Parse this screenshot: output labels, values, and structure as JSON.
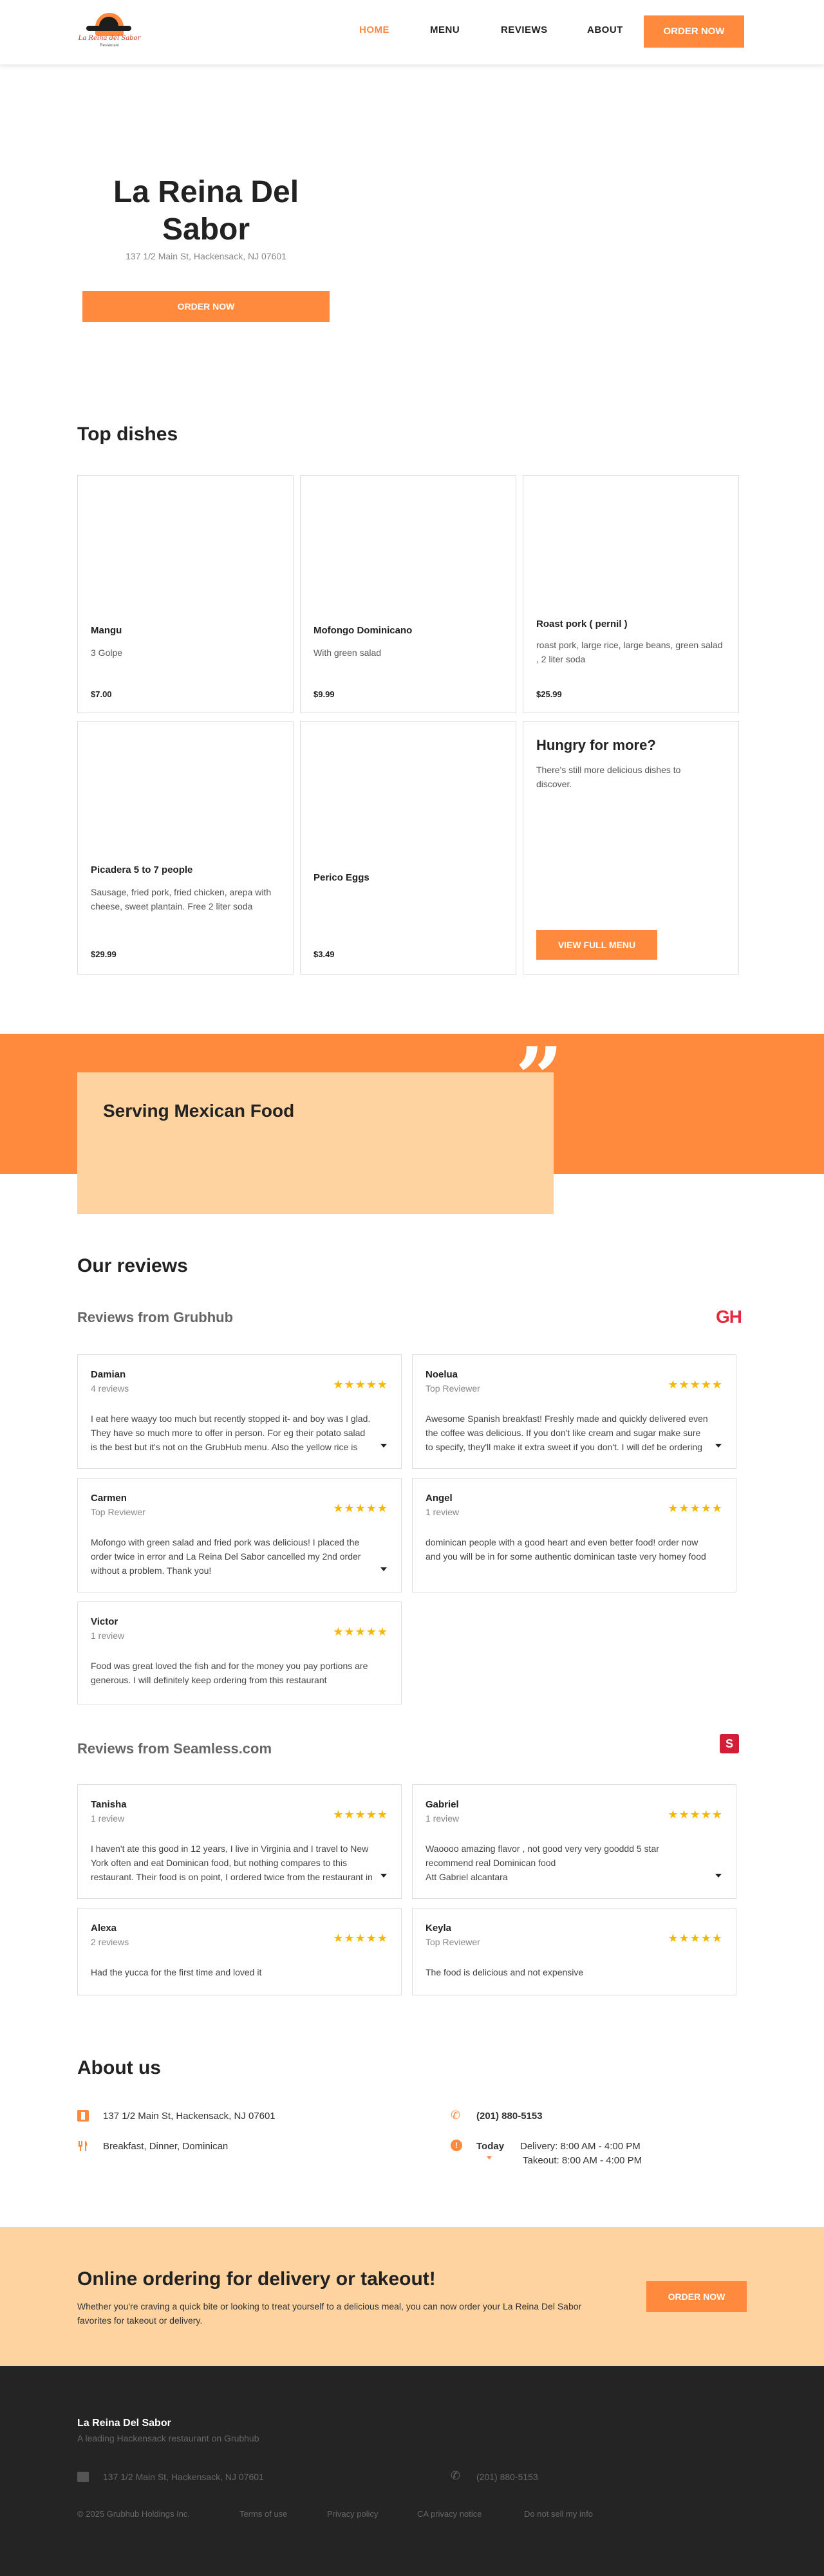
{
  "header": {
    "logo_text": "La Reina del Sabor",
    "logo_subtext": "Restaurant",
    "nav": [
      "HOME",
      "MENU",
      "REVIEWS",
      "ABOUT"
    ],
    "order_label": "ORDER NOW"
  },
  "hero": {
    "title": "La Reina Del Sabor",
    "address": "137 1/2 Main St, Hackensack, NJ 07601",
    "order_label": "ORDER NOW"
  },
  "top_dishes": {
    "heading": "Top dishes",
    "items": [
      {
        "name": "Mangu",
        "desc": "3 Golpe",
        "price": "$7.00"
      },
      {
        "name": "Mofongo Dominicano",
        "desc": "With green salad",
        "price": "$9.99"
      },
      {
        "name": "Roast pork ( pernil )",
        "desc": "roast pork, large rice, large beans, green salad , 2 liter soda",
        "price": "$25.99"
      },
      {
        "name": "Picadera 5 to 7 people",
        "desc": "Sausage, fried pork, fried chicken, arepa with cheese, sweet plantain. Free 2 liter soda",
        "price": "$29.99"
      },
      {
        "name": "Perico Eggs",
        "desc": "",
        "price": "$3.49"
      }
    ],
    "more": {
      "title": "Hungry for more?",
      "desc": "There's still more delicious dishes to discover.",
      "button": "VIEW FULL MENU"
    }
  },
  "band": {
    "title": "Serving Mexican Food"
  },
  "reviews": {
    "heading": "Our reviews",
    "grubhub": {
      "heading": "Reviews from Grubhub",
      "logo": "GH",
      "items": [
        {
          "name": "Damian",
          "sub": "4 reviews",
          "stars": "★★★★★",
          "text": "I eat here waayy too much but recently stopped it- and boy was I glad. They have so much more to offer in person. For eg their potato salad is the best but it's not on the GrubHub menu. Also the yellow rice is cooked differently and that's the best!"
        },
        {
          "name": "Noelua",
          "sub": "Top Reviewer",
          "stars": "★★★★★",
          "text": "Awesome Spanish breakfast! Freshly made and quickly delivered even the coffee was delicious. If you don't like cream and sugar make sure to specify, they'll make it extra sweet if you don't. I will def be ordering again!"
        },
        {
          "name": "Carmen",
          "sub": "Top Reviewer",
          "stars": "★★★★★",
          "text": "Mofongo with green salad and fried pork was delicious! I placed the order twice in error and La Reina Del Sabor cancelled my 2nd order without a problem. Thank you!"
        },
        {
          "name": "Angel",
          "sub": "1 review",
          "stars": "★★★★★",
          "text": "dominican people with a good heart and even better food! order now and you will be in for some authentic dominican taste very homey food"
        },
        {
          "name": "Victor",
          "sub": "1 review",
          "stars": "★★★★★",
          "text": "Food was great loved the fish and for the money you pay portions are generous. I will definitely keep ordering from this restaurant"
        }
      ]
    },
    "seamless": {
      "heading": "Reviews from Seamless.com",
      "logo": "S",
      "items": [
        {
          "name": "Tanisha",
          "sub": "1 review",
          "stars": "★★★★★",
          "text": "I haven't ate this good in 12 years, I live in Virginia and I travel to New York often and eat Dominican food, but nothing compares to this restaurant. Their food is on point, I ordered twice from the restaurant in one day."
        },
        {
          "name": "Gabriel",
          "sub": "1 review",
          "stars": "★★★★★",
          "text": "Waoooo amazing flavor , not good very very gooddd 5 star recommend real Dominican food\nAtt Gabriel alcantara"
        },
        {
          "name": "Alexa",
          "sub": "2 reviews",
          "stars": "★★★★★",
          "text": "Had the yucca for the first time and loved it"
        },
        {
          "name": "Keyla",
          "sub": "Top Reviewer",
          "stars": "★★★★★",
          "text": "The food is delicious and not expensive"
        }
      ]
    }
  },
  "about": {
    "heading": "About us",
    "address": "137 1/2 Main St, Hackensack, NJ 07601",
    "cuisine": "Breakfast, Dinner, Dominican",
    "phone": "(201) 880-5153",
    "hours_day": "Today",
    "delivery": "Delivery: 8:00 AM - 4:00 PM",
    "takeout": "Takeout: 8:00 AM - 4:00 PM"
  },
  "ordering": {
    "title": "Online ordering for delivery or takeout!",
    "desc": "Whether you're craving a quick bite or looking to treat yourself to a delicious meal, you can now order your La Reina Del Sabor favorites for takeout or delivery.",
    "button": "ORDER NOW"
  },
  "footer": {
    "name": "La Reina Del Sabor",
    "tagline": "A leading Hackensack restaurant on Grubhub",
    "address": "137 1/2 Main St, Hackensack, NJ 07601",
    "phone": "(201) 880-5153",
    "links": [
      "© 2025 Grubhub Holdings Inc.",
      "Terms of use",
      "Privacy policy",
      "CA privacy notice",
      "Do not sell my info"
    ]
  },
  "colors": {
    "accent": "#ff8a3d",
    "peach": "#ffd39f",
    "star": "#f5b800",
    "footer": "#242424"
  }
}
